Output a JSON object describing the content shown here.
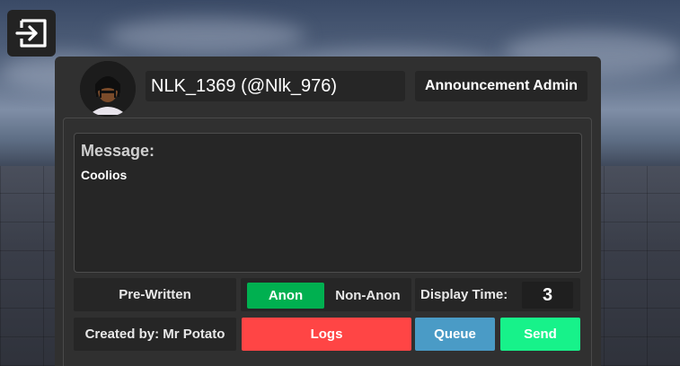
{
  "exit": {
    "icon": "exit-icon"
  },
  "header": {
    "username": "NLK_1369 (@Nlk_976)",
    "panel_title": "Announcement Admin"
  },
  "message": {
    "label": "Message:",
    "text": "Coolios"
  },
  "controls": {
    "prewritten_label": "Pre-Written",
    "anon_label": "Anon",
    "nonanon_label": "Non-Anon",
    "display_time_label": "Display Time:",
    "display_time_value": "3",
    "created_by": "Created by: Mr Potato",
    "logs_label": "Logs",
    "queue_label": "Queue",
    "send_label": "Send"
  },
  "colors": {
    "anon": "#00b050",
    "logs": "#ff4545",
    "queue": "#4a9bc6",
    "send": "#17f28a"
  }
}
